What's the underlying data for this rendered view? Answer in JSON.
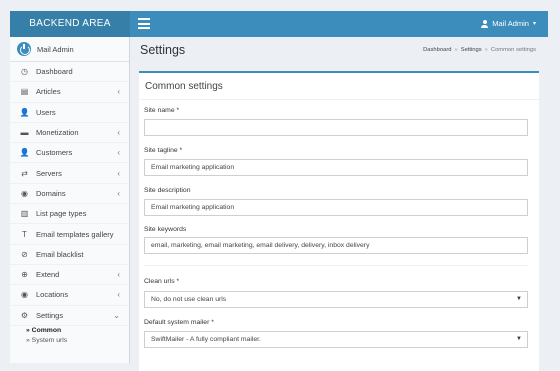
{
  "header": {
    "brand": "BACKEND AREA",
    "user_name": "Mail Admin",
    "caret": "▾"
  },
  "sidebar": {
    "profile_name": "Mail Admin",
    "items": [
      {
        "label": "Dashboard",
        "icon": "◷",
        "icon_name": "dashboard-icon",
        "arrow": ""
      },
      {
        "label": "Articles",
        "icon": "▤",
        "icon_name": "book-icon",
        "arrow": "‹"
      },
      {
        "label": "Users",
        "icon": "👤",
        "icon_name": "user-icon",
        "arrow": ""
      },
      {
        "label": "Monetization",
        "icon": "▬",
        "icon_name": "credit-card-icon",
        "arrow": "‹"
      },
      {
        "label": "Customers",
        "icon": "👤",
        "icon_name": "customers-icon",
        "arrow": "‹"
      },
      {
        "label": "Servers",
        "icon": "⇄",
        "icon_name": "servers-icon",
        "arrow": "‹"
      },
      {
        "label": "Domains",
        "icon": "◉",
        "icon_name": "globe-icon",
        "arrow": "‹"
      },
      {
        "label": "List page types",
        "icon": "▥",
        "icon_name": "list-icon",
        "arrow": ""
      },
      {
        "label": "Email templates gallery",
        "icon": "T",
        "icon_name": "text-icon",
        "arrow": ""
      },
      {
        "label": "Email blacklist",
        "icon": "⊘",
        "icon_name": "ban-icon",
        "arrow": ""
      },
      {
        "label": "Extend",
        "icon": "⊕",
        "icon_name": "plus-circle-icon",
        "arrow": "‹"
      },
      {
        "label": "Locations",
        "icon": "◉",
        "icon_name": "locations-icon",
        "arrow": "‹"
      },
      {
        "label": "Settings",
        "icon": "⚙",
        "icon_name": "gear-icon",
        "arrow": "⌄"
      }
    ],
    "sub_items": [
      {
        "label": "» Common",
        "active": true
      },
      {
        "label": "» System urls",
        "active": false
      }
    ]
  },
  "page": {
    "title": "Settings",
    "breadcrumb": [
      "Dashboard",
      "Settings",
      "Common settings"
    ],
    "breadcrumb_sep": "»"
  },
  "form": {
    "box_title": "Common settings",
    "site_name_label": "Site name *",
    "site_name_value": "",
    "site_tagline_label": "Site tagline *",
    "site_tagline_value": "Email marketing application",
    "site_description_label": "Site description",
    "site_description_value": "Email marketing application",
    "site_keywords_label": "Site keywords",
    "site_keywords_value": "email, marketing, email marketing, email delivery, delivery, inbox delivery",
    "clean_urls_label": "Clean urls *",
    "clean_urls_value": "No, do not use clean urls",
    "default_mailer_label": "Default system mailer *",
    "default_mailer_value": "SwiftMailer - A fully compliant mailer."
  },
  "colors": {
    "accent": "#3c8dbc",
    "brand_bg": "#367fa9",
    "sidebar_bg": "#f9fafc",
    "page_bg": "#ecf0f5"
  }
}
